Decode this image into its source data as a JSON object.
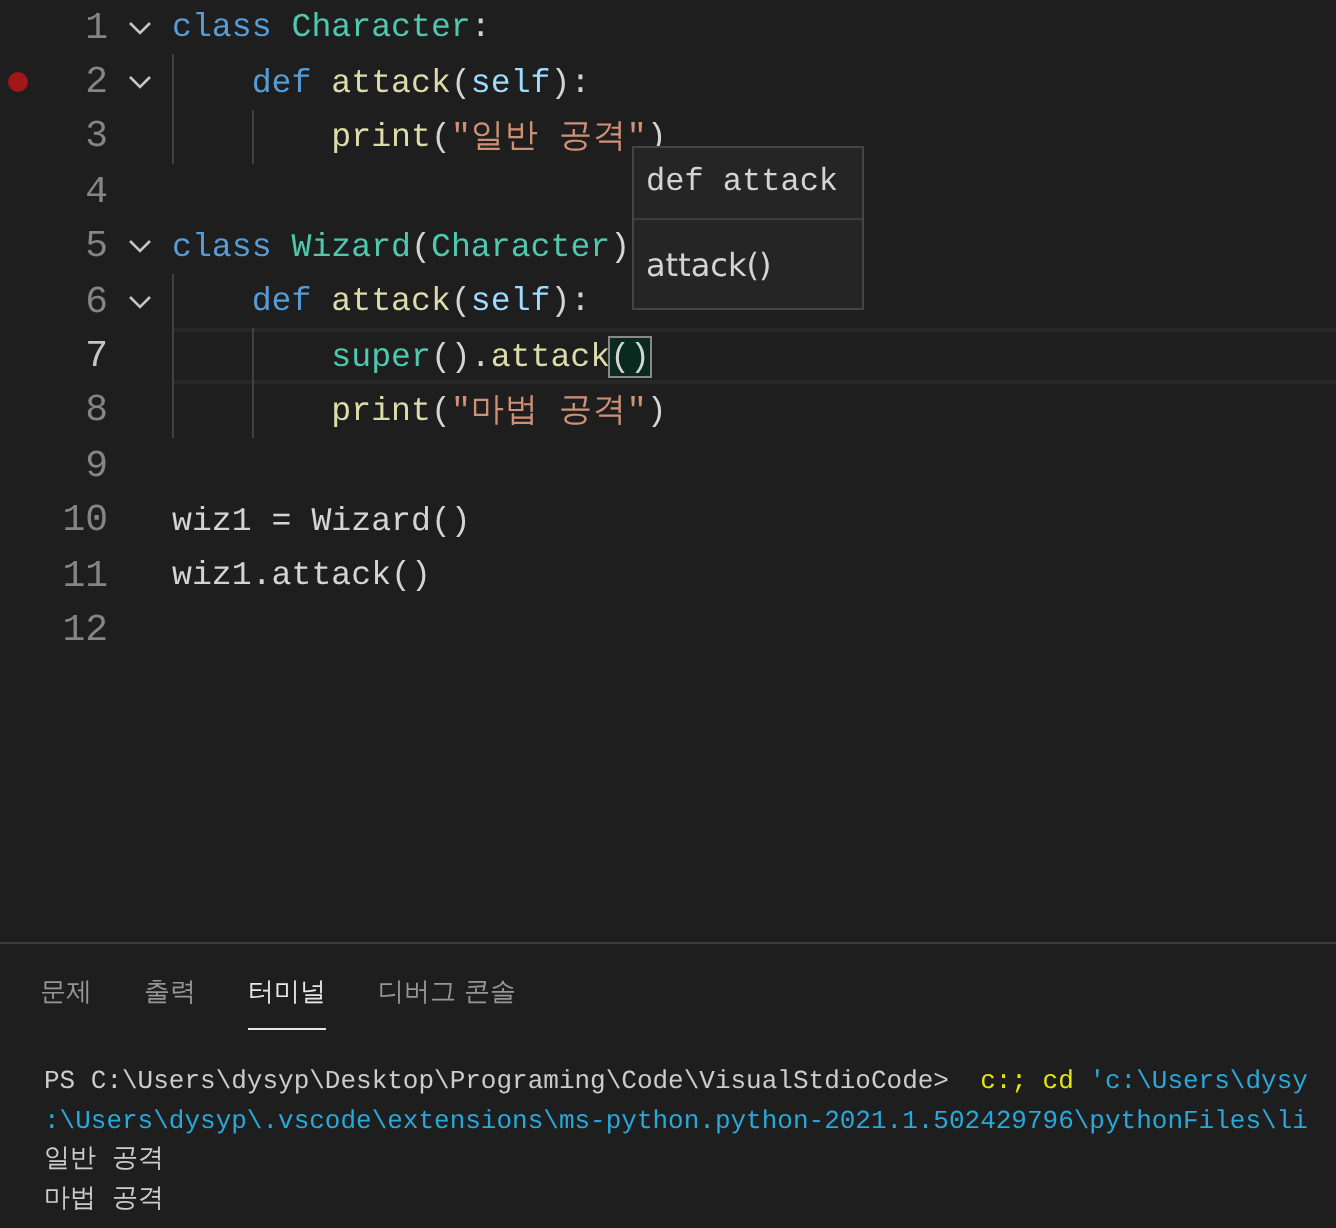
{
  "editor": {
    "lines": [
      {
        "number": "1",
        "fold": true,
        "breakpoint": false,
        "current": false,
        "tokens": [
          {
            "kind": "keyword",
            "text": "class"
          },
          {
            "kind": "class",
            "text": " Character"
          },
          {
            "kind": "plain",
            "text": ":"
          }
        ]
      },
      {
        "number": "2",
        "fold": true,
        "breakpoint": true,
        "current": false,
        "tokens": [
          {
            "kind": "keyword",
            "text": "    def"
          },
          {
            "kind": "func",
            "text": " attack"
          },
          {
            "kind": "plain",
            "text": "("
          },
          {
            "kind": "param",
            "text": "self"
          },
          {
            "kind": "plain",
            "text": "):"
          }
        ]
      },
      {
        "number": "3",
        "fold": false,
        "breakpoint": false,
        "current": false,
        "tokens": [
          {
            "kind": "func",
            "text": "        print"
          },
          {
            "kind": "plain",
            "text": "("
          },
          {
            "kind": "string",
            "text": "\"일반 공격\""
          },
          {
            "kind": "plain",
            "text": ")"
          }
        ]
      },
      {
        "number": "4",
        "fold": false,
        "breakpoint": false,
        "current": false
      },
      {
        "number": "5",
        "fold": true,
        "breakpoint": false,
        "current": false,
        "tokens": [
          {
            "kind": "keyword",
            "text": "class"
          },
          {
            "kind": "class",
            "text": " Wizard"
          },
          {
            "kind": "plain",
            "text": "("
          },
          {
            "kind": "class",
            "text": "Character"
          },
          {
            "kind": "plain",
            "text": ")"
          }
        ]
      },
      {
        "number": "6",
        "fold": true,
        "breakpoint": false,
        "current": false,
        "tokens": [
          {
            "kind": "keyword",
            "text": "    def"
          },
          {
            "kind": "func",
            "text": " attack"
          },
          {
            "kind": "plain",
            "text": "("
          },
          {
            "kind": "param",
            "text": "self"
          },
          {
            "kind": "plain",
            "text": "):"
          }
        ]
      },
      {
        "number": "7",
        "fold": false,
        "breakpoint": false,
        "current": true,
        "tokens": [
          {
            "kind": "class",
            "text": "        super"
          },
          {
            "kind": "plain",
            "text": "()."
          },
          {
            "kind": "func",
            "text": "attack"
          },
          {
            "kind": "match",
            "text": "()"
          }
        ]
      },
      {
        "number": "8",
        "fold": false,
        "breakpoint": false,
        "current": false,
        "tokens": [
          {
            "kind": "func",
            "text": "        print"
          },
          {
            "kind": "plain",
            "text": "("
          },
          {
            "kind": "string",
            "text": "\"마법 공격\""
          },
          {
            "kind": "plain",
            "text": ")"
          }
        ]
      },
      {
        "number": "9",
        "fold": false,
        "breakpoint": false,
        "current": false
      },
      {
        "number": "10",
        "fold": false,
        "breakpoint": false,
        "current": false,
        "tokens": [
          {
            "kind": "plain",
            "text": "wiz1 = Wizard()"
          }
        ]
      },
      {
        "number": "11",
        "fold": false,
        "breakpoint": false,
        "current": false,
        "tokens": [
          {
            "kind": "plain",
            "text": "wiz1.attack()"
          }
        ]
      },
      {
        "number": "12",
        "fold": false,
        "breakpoint": false,
        "current": false
      }
    ],
    "hover": {
      "signature": "def attack",
      "doc": "attack()"
    }
  },
  "panel": {
    "tabs": [
      {
        "label": "문제",
        "selected": false
      },
      {
        "label": "출력",
        "selected": false
      },
      {
        "label": "터미널",
        "selected": true
      },
      {
        "label": "디버그 콘솔",
        "selected": false
      }
    ],
    "terminal": [
      [
        {
          "kind": "plain",
          "text": "PS C:\\Users\\dysyp\\Desktop\\Programing\\Code\\VisualStdioCode> "
        },
        {
          "kind": "command",
          "text": " c:; cd "
        },
        {
          "kind": "path",
          "text": "'c:\\Users\\dysy"
        }
      ],
      [
        {
          "kind": "path",
          "text": ":\\Users\\dysyp\\.vscode\\extensions\\ms-python.python-2021.1.502429796\\pythonFiles\\li"
        }
      ],
      [
        {
          "kind": "plain",
          "text": "일반 공격"
        }
      ],
      [
        {
          "kind": "plain",
          "text": "마법 공격"
        }
      ]
    ]
  }
}
